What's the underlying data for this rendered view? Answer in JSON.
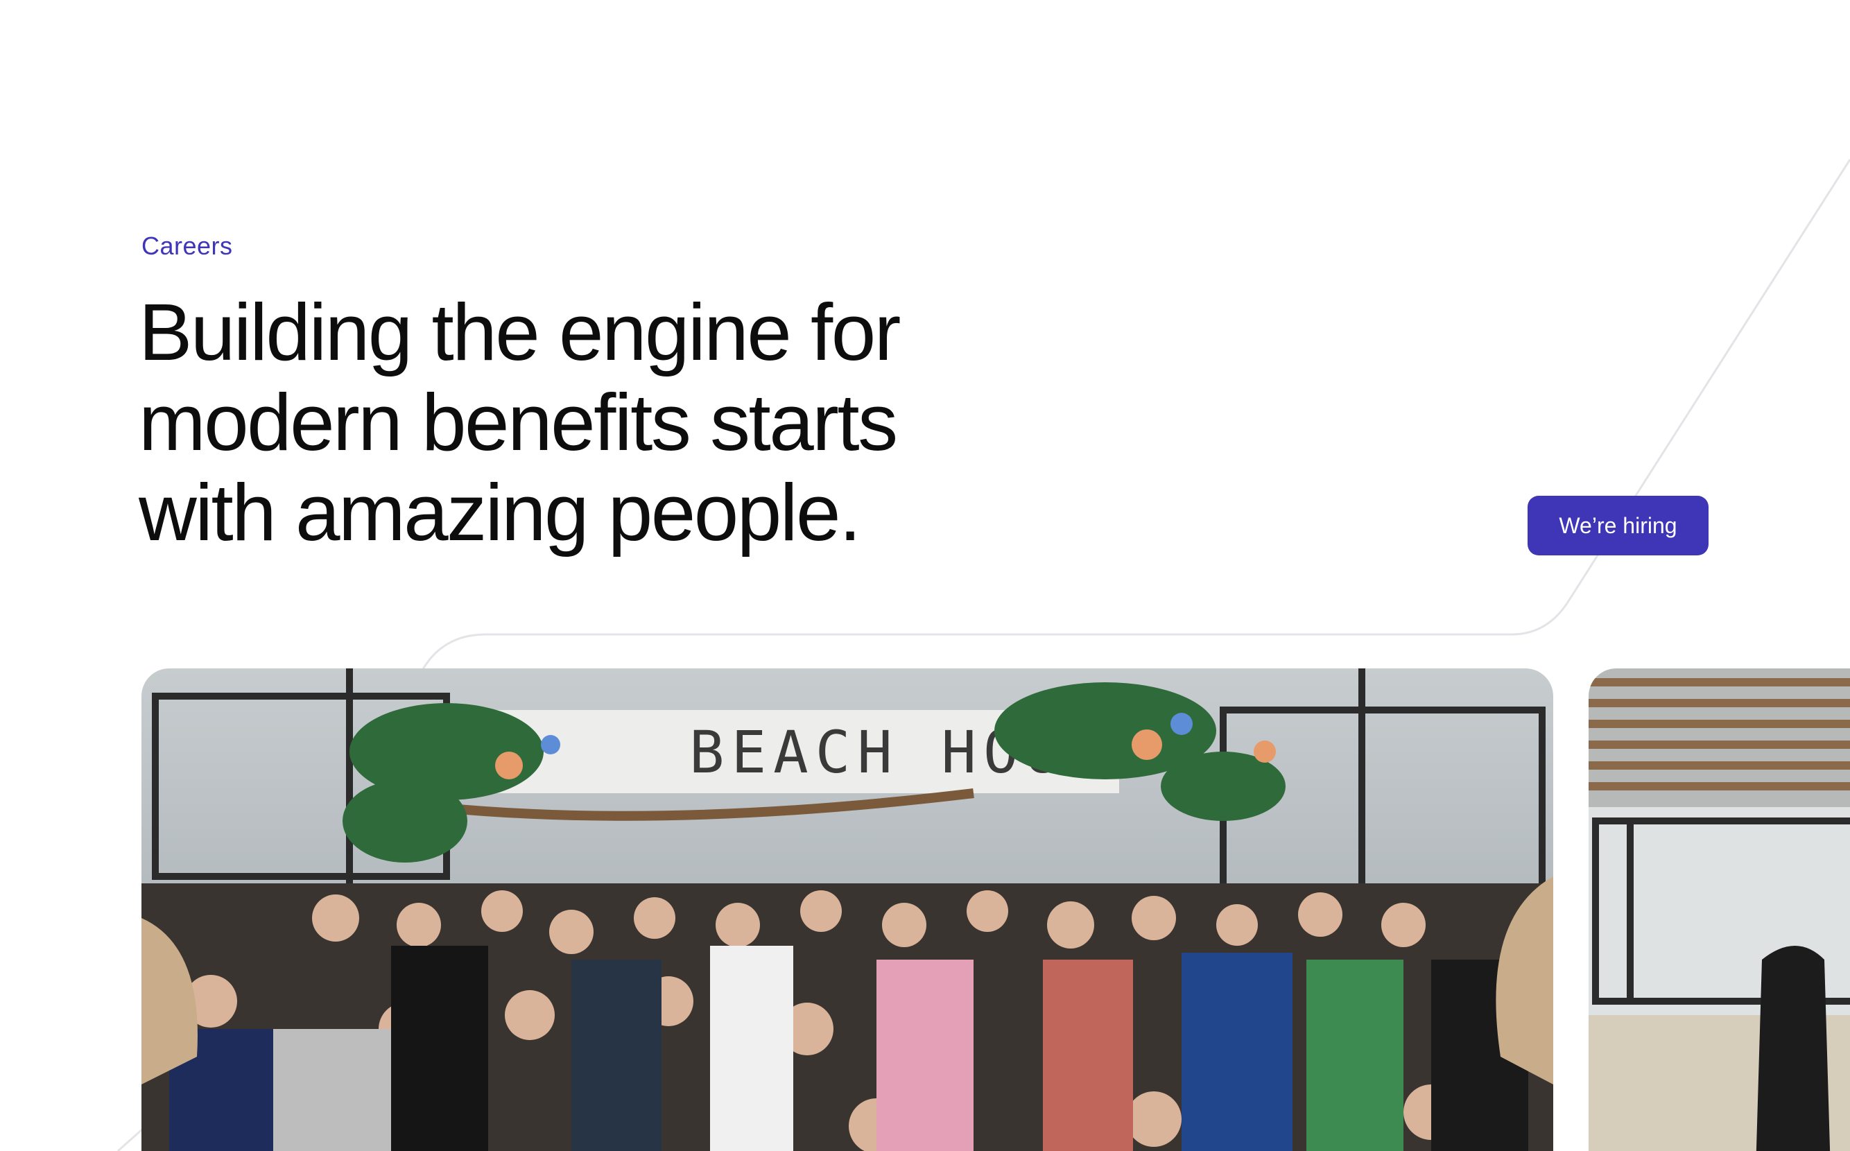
{
  "hero": {
    "eyebrow": "Careers",
    "headline": "Building the engine for modern benefits starts with amazing people.",
    "cta_label": "We’re hiring"
  },
  "photos": {
    "main_sign_text": "BEACH HOUSE"
  },
  "colors": {
    "brand": "#3f35b7",
    "text": "#0d0d0d",
    "background": "#ffffff",
    "deco_line": "#e4e4e8"
  }
}
